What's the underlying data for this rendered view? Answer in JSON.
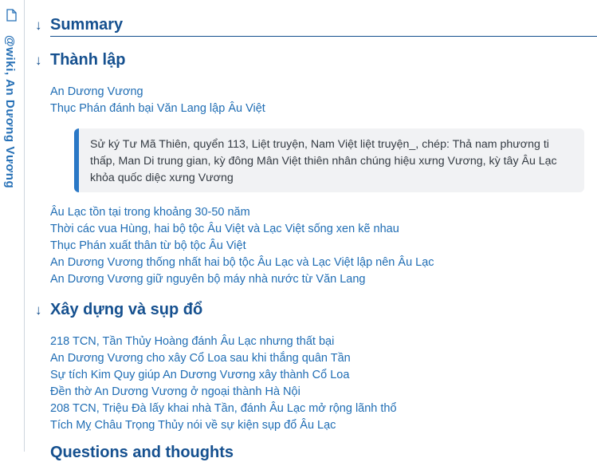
{
  "sidebar": {
    "title": "@wiki, An Dương Vương",
    "icon": "document-icon"
  },
  "sections": {
    "summary": {
      "heading": "Summary",
      "arrow": "↓"
    },
    "thanh_lap": {
      "heading": "Thành lập",
      "arrow": "↓",
      "links_a": [
        "An Dương Vương",
        "Thục Phán đánh bại Văn Lang lập Âu Việt"
      ],
      "quote": "Sử ký Tư Mã Thiên, quyển 113, Liệt truyện, Nam Việt liệt truyện_, chép: Thả nam phương ti thấp, Man Di trung gian, kỳ đông Mân Việt thiên nhân chúng hiệu xưng Vương, kỳ tây Âu Lạc khỏa quốc diệc xưng Vương",
      "links_b": [
        "Âu Lạc tồn tại trong khoảng 30-50 năm",
        "Thời các vua Hùng, hai bộ tộc Âu Việt và Lạc Việt sống xen kẽ nhau",
        "Thục Phán xuất thân từ bộ tộc Âu Việt",
        "An Dương Vương thống nhất hai bộ tộc Âu Lạc và Lạc Việt lập nên Âu Lạc",
        "An Dương Vương giữ nguyên bộ máy nhà nước từ Văn Lang"
      ]
    },
    "xay_dung": {
      "heading": "Xây dựng và sụp đổ",
      "arrow": "↓",
      "links": [
        "218 TCN, Tần Thủy Hoàng đánh Âu Lạc nhưng thất bại",
        "An Dương Vương cho xây Cổ Loa sau khi thắng quân Tần",
        "Sự tích Kim Quy giúp An Dương Vương xây thành Cổ Loa",
        "Đền thờ An Dương Vương ở ngoại thành Hà Nội",
        "208 TCN, Triệu Đà lấy khai nhà Tần, đánh Âu Lạc mở rộng lãnh thổ",
        "Tích Mỵ Châu Trọng Thủy nói về sự kiện sụp đổ Âu Lạc"
      ]
    },
    "next_heading": "Questions and thoughts"
  },
  "colors": {
    "link": "#1f6db4",
    "heading": "#15508f",
    "quote_bar": "#2a78c6",
    "quote_bg": "#f1f2f4"
  }
}
